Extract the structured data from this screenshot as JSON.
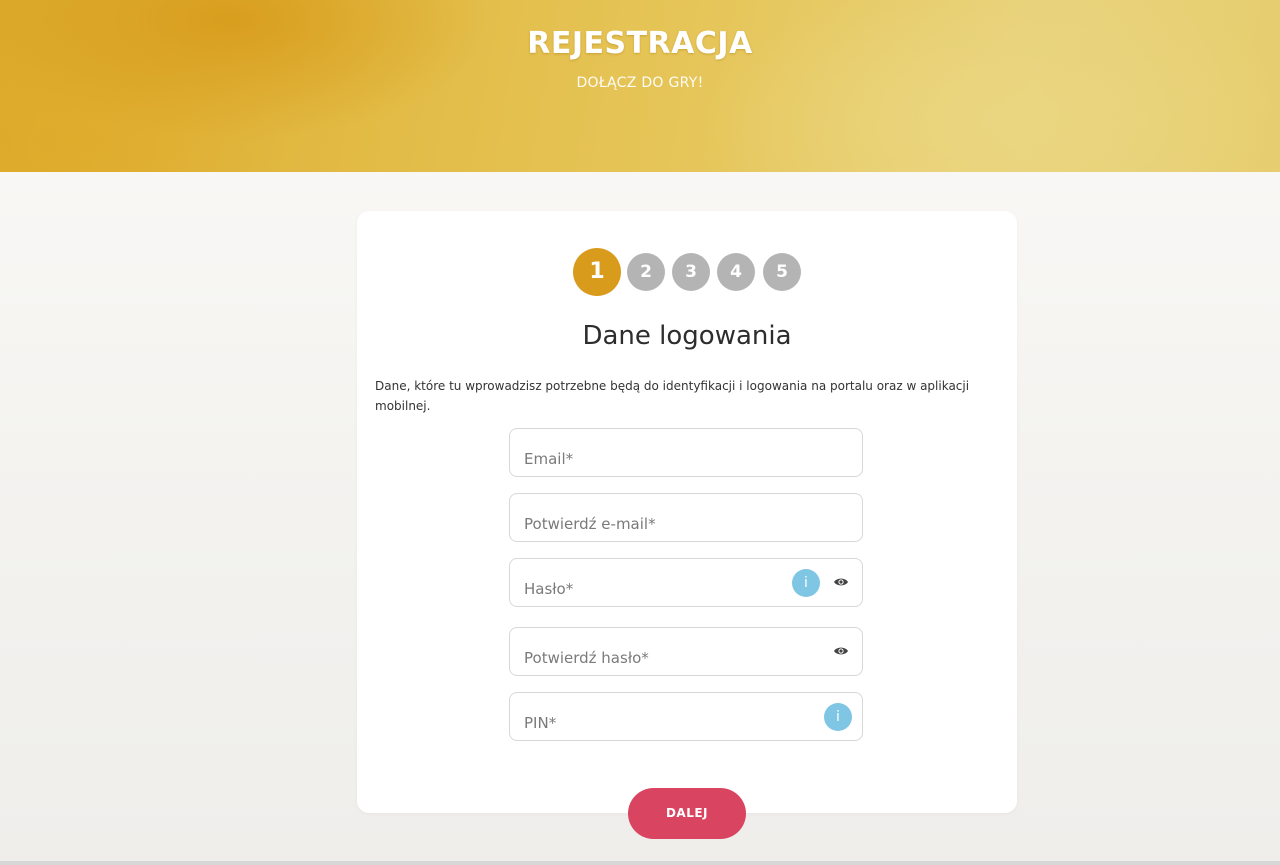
{
  "header": {
    "title": "REJESTRACJA",
    "subtitle": "DOŁĄCZ DO GRY!"
  },
  "steps": {
    "current": 1,
    "items": [
      "1",
      "2",
      "3",
      "4",
      "5"
    ]
  },
  "form": {
    "title": "Dane logowania",
    "description": "Dane, które tu wprowadzisz potrzebne będą do identyfikacji i logowania na portalu oraz w aplikacji mobilnej.",
    "fields": [
      {
        "placeholder": "Email*",
        "value": ""
      },
      {
        "placeholder": "Potwierdź e-mail*",
        "value": ""
      },
      {
        "placeholder": "Hasło*",
        "value": "",
        "info_icon": "i",
        "eye_icon": "eye-icon"
      },
      {
        "placeholder": "Potwierdź hasło*",
        "value": "",
        "eye_icon": "eye-icon"
      },
      {
        "placeholder": "PIN*",
        "value": "",
        "info_icon": "i"
      }
    ],
    "next_label": "DALEJ"
  },
  "colors": {
    "accent": "#d99b1c",
    "step_inactive": "#b4b4b4",
    "info": "#7ec6e3",
    "button": "#d94560"
  }
}
